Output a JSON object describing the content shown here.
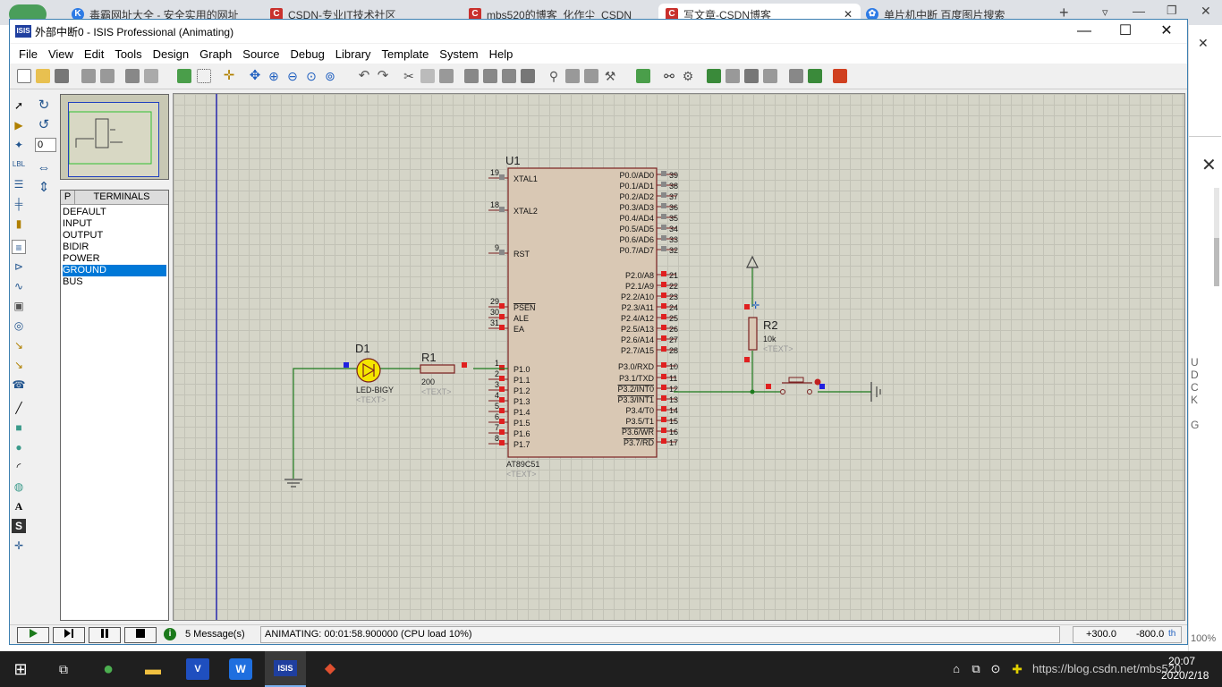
{
  "browser": {
    "tabs": [
      {
        "label": "毒霸网址大全 - 安全实用的网址",
        "icon": "k-icon",
        "color": "#2d7be5"
      },
      {
        "label": "CSDN-专业IT技术社区",
        "icon": "csdn-icon",
        "color": "#c9302c"
      },
      {
        "label": "mbs520的博客_化作尘_CSDN",
        "icon": "csdn-icon",
        "color": "#c9302c"
      },
      {
        "label": "写文章-CSDN博客",
        "icon": "csdn-icon",
        "color": "#c9302c"
      },
      {
        "label": "单片机中断 百度图片搜索",
        "icon": "baidu-icon",
        "color": "#2d7be5"
      }
    ],
    "side_letters": [
      "U",
      "D",
      "C",
      "K",
      "",
      "G"
    ],
    "zoom": "100%"
  },
  "window": {
    "title": "外部中断0 - ISIS Professional (Animating)",
    "icon_text": "ISIS",
    "minimize": "—",
    "maximize": "☐",
    "close": "✕"
  },
  "menu": [
    "File",
    "View",
    "Edit",
    "Tools",
    "Design",
    "Graph",
    "Source",
    "Debug",
    "Library",
    "Template",
    "System",
    "Help"
  ],
  "left_tools": {
    "rotation_value": "0"
  },
  "terminals": {
    "header_p": "P",
    "header": "TERMINALS",
    "items": [
      "DEFAULT",
      "INPUT",
      "OUTPUT",
      "BIDIR",
      "POWER",
      "GROUND",
      "BUS"
    ],
    "selected": "GROUND"
  },
  "schematic": {
    "u1": {
      "ref": "U1",
      "part": "AT89C51",
      "text": "<TEXT>",
      "left_pins": [
        {
          "num": "19",
          "name": "XTAL1"
        },
        {
          "num": "18",
          "name": "XTAL2"
        },
        {
          "num": "9",
          "name": "RST"
        },
        {
          "num": "29",
          "name": "PSEN"
        },
        {
          "num": "30",
          "name": "ALE"
        },
        {
          "num": "31",
          "name": "EA"
        },
        {
          "num": "1",
          "name": "P1.0"
        },
        {
          "num": "2",
          "name": "P1.1"
        },
        {
          "num": "3",
          "name": "P1.2"
        },
        {
          "num": "4",
          "name": "P1.3"
        },
        {
          "num": "5",
          "name": "P1.4"
        },
        {
          "num": "6",
          "name": "P1.5"
        },
        {
          "num": "7",
          "name": "P1.6"
        },
        {
          "num": "8",
          "name": "P1.7"
        }
      ],
      "right_pins": [
        {
          "num": "39",
          "name": "P0.0/AD0"
        },
        {
          "num": "38",
          "name": "P0.1/AD1"
        },
        {
          "num": "37",
          "name": "P0.2/AD2"
        },
        {
          "num": "36",
          "name": "P0.3/AD3"
        },
        {
          "num": "35",
          "name": "P0.4/AD4"
        },
        {
          "num": "34",
          "name": "P0.5/AD5"
        },
        {
          "num": "33",
          "name": "P0.6/AD6"
        },
        {
          "num": "32",
          "name": "P0.7/AD7"
        },
        {
          "num": "21",
          "name": "P2.0/A8"
        },
        {
          "num": "22",
          "name": "P2.1/A9"
        },
        {
          "num": "23",
          "name": "P2.2/A10"
        },
        {
          "num": "24",
          "name": "P2.3/A11"
        },
        {
          "num": "25",
          "name": "P2.4/A12"
        },
        {
          "num": "26",
          "name": "P2.5/A13"
        },
        {
          "num": "27",
          "name": "P2.6/A14"
        },
        {
          "num": "28",
          "name": "P2.7/A15"
        },
        {
          "num": "10",
          "name": "P3.0/RXD"
        },
        {
          "num": "11",
          "name": "P3.1/TXD"
        },
        {
          "num": "12",
          "name": "P3.2/INT0"
        },
        {
          "num": "13",
          "name": "P3.3/INT1"
        },
        {
          "num": "14",
          "name": "P3.4/T0"
        },
        {
          "num": "15",
          "name": "P3.5/T1"
        },
        {
          "num": "16",
          "name": "P3.6/WR"
        },
        {
          "num": "17",
          "name": "P3.7/RD"
        }
      ]
    },
    "d1": {
      "ref": "D1",
      "part": "LED-BIGY",
      "text": "<TEXT>"
    },
    "r1": {
      "ref": "R1",
      "value": "200",
      "text": "<TEXT>"
    },
    "r2": {
      "ref": "R2",
      "value": "10k",
      "text": "<TEXT>"
    }
  },
  "status": {
    "messages": "5 Message(s)",
    "animating": "ANIMATING: 00:01:58.900000 (CPU load 10%)",
    "x": "+300.0",
    "y": "-800.0",
    "unit": "th"
  },
  "taskbar": {
    "time": "20:07",
    "date": "2020/2/18",
    "watermark": "https://blog.csdn.net/mbs520"
  },
  "colors": {
    "accent": "#0078d7",
    "pin_high": "#e02020",
    "pin_low": "#2020e0",
    "wire": "#1c7a1c",
    "ic_fill": "#d9c8b4"
  }
}
